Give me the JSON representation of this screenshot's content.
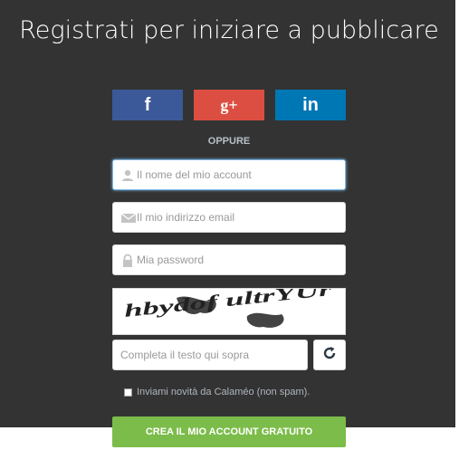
{
  "header": {
    "title": "Registrati per iniziare a pubblicare"
  },
  "social": {
    "facebook_label": "f",
    "googleplus_label": "g+",
    "linkedin_label": "in"
  },
  "divider": {
    "text": "OPPURE"
  },
  "form": {
    "username": {
      "value": "",
      "placeholder": "Il nome del mio account"
    },
    "email": {
      "value": "",
      "placeholder": "Il mio indirizzo email"
    },
    "password": {
      "value": "",
      "placeholder": "Mia password"
    },
    "captcha": {
      "value": "",
      "placeholder": "Completa il testo qui sopra",
      "image_text": "hbydof ultrYUr"
    },
    "newsletter_label": "Inviami novità da Calaméo (non spam).",
    "submit_label": "CREA IL MIO ACCOUNT GRATUITO"
  },
  "colors": {
    "panel_bg": "#333333",
    "facebook": "#3b5998",
    "googleplus": "#dc4e41",
    "linkedin": "#0077b5",
    "submit": "#7cbc4a",
    "focus_border": "#7ab8e6"
  },
  "icons": {
    "username": "user-icon",
    "email": "envelope-icon",
    "password": "lock-icon",
    "refresh": "refresh-icon"
  }
}
